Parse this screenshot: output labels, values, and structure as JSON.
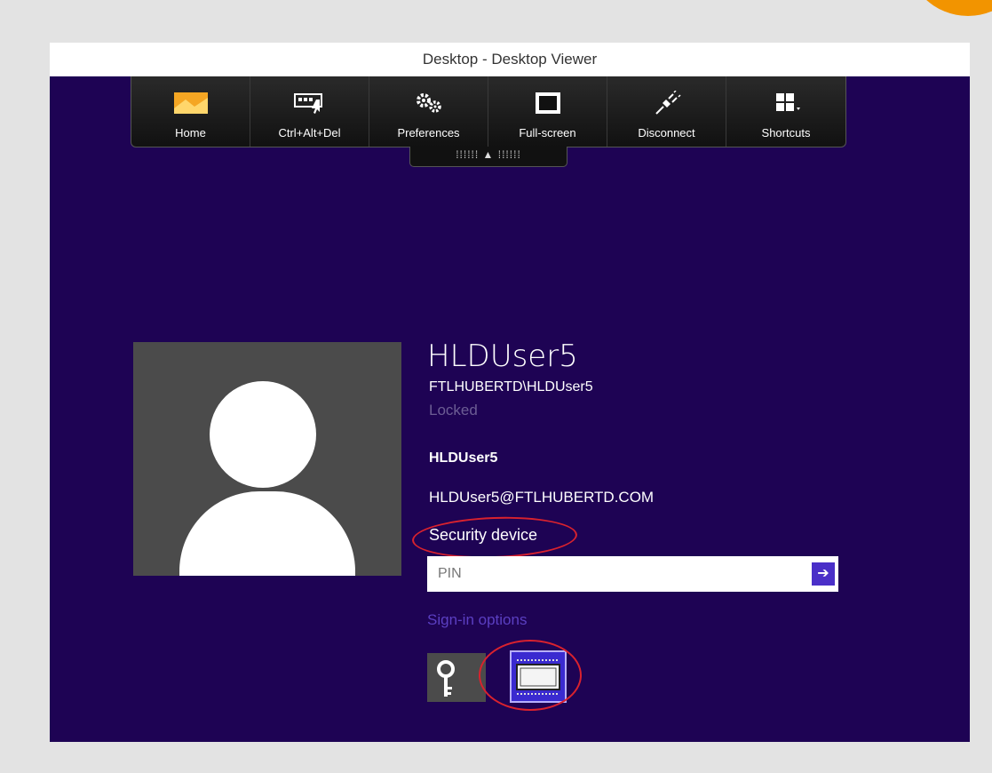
{
  "window": {
    "title": "Desktop - Desktop Viewer"
  },
  "toolbar": {
    "buttons": [
      {
        "label": "Home",
        "icon": "home-icon"
      },
      {
        "label": "Ctrl+Alt+Del",
        "icon": "keyboard-icon"
      },
      {
        "label": "Preferences",
        "icon": "gears-icon"
      },
      {
        "label": "Full-screen",
        "icon": "full-screen-icon"
      },
      {
        "label": "Disconnect",
        "icon": "plug-icon"
      },
      {
        "label": "Shortcuts",
        "icon": "grid-icon"
      }
    ],
    "handle": "⁞⁞⁞⁞⁞⁞ ▲ ⁞⁞⁞⁞⁞⁞"
  },
  "login": {
    "display_name": "HLDUser5",
    "domain_user": "FTLHUBERTD\\HLDUser5",
    "status": "Locked",
    "account_name": "HLDUser5",
    "email": "HLDUser5@FTLHUBERTD.COM",
    "credential_type": "Security device",
    "pin_placeholder": "PIN",
    "submit_glyph": "➔",
    "sign_in_options": "Sign-in options"
  },
  "colors": {
    "background": "#1e0354",
    "accent": "#4a2fc8",
    "highlight": "#d9222e"
  }
}
